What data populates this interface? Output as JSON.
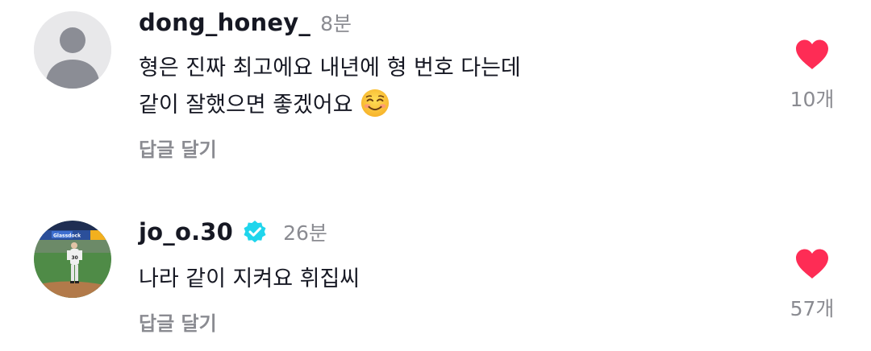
{
  "comments": [
    {
      "username": "dong_honey_",
      "time_ago": "8분",
      "verified": false,
      "lines": [
        "형은 진짜 최고에요 내년에 형 번호 다는데",
        "같이 잘했으면 좋겠어요"
      ],
      "emoji": "smiling-face-icon",
      "reply_label": "답글 달기",
      "like_count": "10개",
      "heart_color": "#fe2c55"
    },
    {
      "username": "jo_o.30",
      "time_ago": "26분",
      "verified": true,
      "verified_color": "#20d5ec",
      "lines": [
        "나라 같이 지켜요 휘집씨"
      ],
      "reply_label": "답글 달기",
      "like_count": "57개",
      "heart_color": "#fe2c55",
      "avatar_jersey_number": "30",
      "avatar_banner_text": "Glassdock"
    }
  ]
}
